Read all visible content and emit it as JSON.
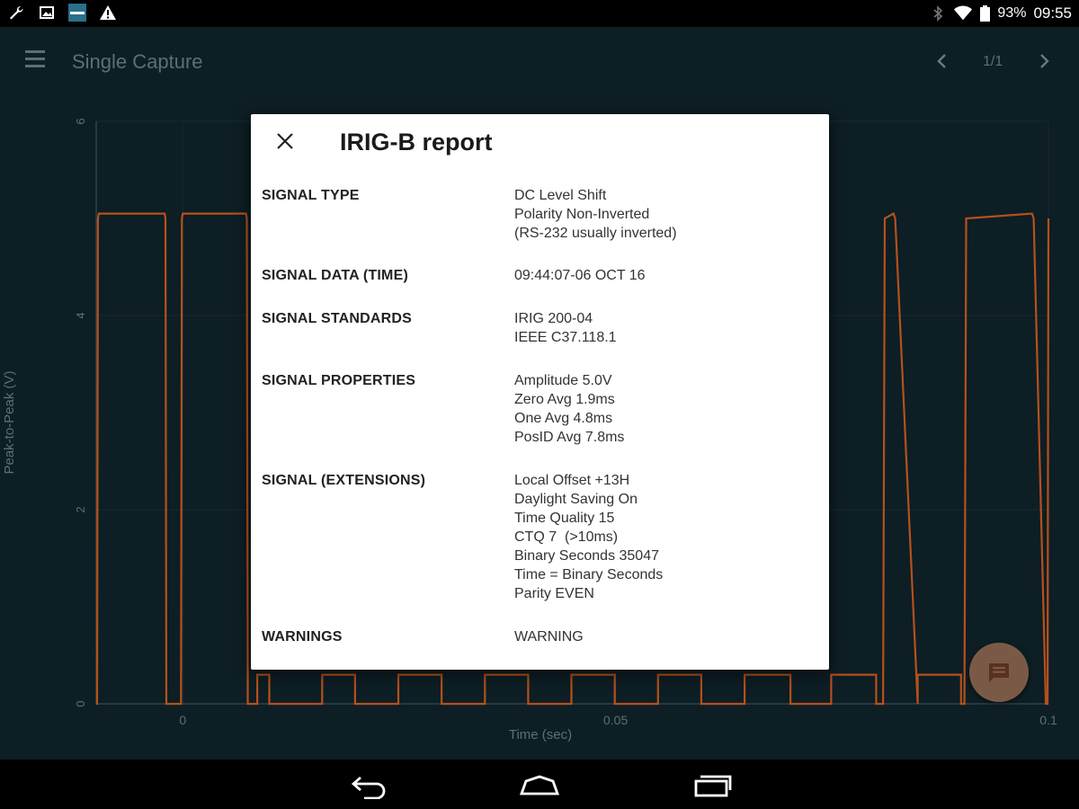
{
  "status_bar": {
    "battery": "93%",
    "time": "09:55",
    "left_icons": [
      "wrench-icon",
      "image-icon",
      "app-icon",
      "warning-icon"
    ],
    "right_icons": [
      "bluetooth-icon",
      "wifi-icon",
      "battery-icon"
    ]
  },
  "toolbar": {
    "title": "Single Capture",
    "page_indicator": "1/1"
  },
  "chart_data": {
    "type": "line",
    "xlabel": "Time (sec)",
    "ylabel": "Peak-to-Peak (V)",
    "x_ticks": [
      "0",
      "0.05",
      "0.1"
    ],
    "y_ticks": [
      "0",
      "2",
      "4",
      "6"
    ],
    "xlim": [
      -0.01,
      0.1
    ],
    "ylim": [
      0,
      6
    ],
    "line_color": "#b5501c",
    "series": [
      {
        "x": [
          -0.01,
          -0.0099,
          -0.0098,
          -0.0097,
          -0.0021,
          -0.002,
          -0.0019,
          -0.0002,
          -0.0001,
          0.0,
          0.0073,
          0.0074,
          0.0075,
          0.0075,
          0.0086,
          0.0086,
          0.01,
          0.01,
          0.0161,
          0.0161,
          0.0199,
          0.0199,
          0.0249,
          0.0249,
          0.0299,
          0.0299,
          0.0349,
          0.0349,
          0.0399,
          0.0399,
          0.0449,
          0.0449,
          0.0499,
          0.0499,
          0.0549,
          0.0549,
          0.0599,
          0.0599,
          0.0649,
          0.0649,
          0.0702,
          0.0702,
          0.0749,
          0.0749,
          0.0801,
          0.0801,
          0.0809,
          0.0811,
          0.0821,
          0.0823,
          0.0849,
          0.0849,
          0.0899,
          0.0899,
          0.0903,
          0.0905,
          0.0981,
          0.0983,
          0.0997,
          0.0999,
          0.1
        ],
        "y": [
          0,
          0,
          5.0,
          5.05,
          5.05,
          5.0,
          0,
          0,
          5.0,
          5.05,
          5.05,
          5.0,
          0.3,
          0,
          0,
          0.3,
          0.3,
          0,
          0,
          0.3,
          0.3,
          0,
          0,
          0.3,
          0.3,
          0,
          0,
          0.3,
          0.3,
          0,
          0,
          0.3,
          0.3,
          0,
          0,
          0.3,
          0.3,
          0,
          0,
          0.3,
          0.3,
          0,
          0,
          0.3,
          0.3,
          0,
          0,
          5.0,
          5.05,
          5.0,
          0,
          0.3,
          0.3,
          0,
          0,
          5.0,
          5.05,
          5.0,
          0,
          0,
          5.0
        ]
      }
    ]
  },
  "dialog": {
    "title": "IRIG-B report",
    "rows": [
      {
        "label": "SIGNAL TYPE",
        "values": [
          "DC Level Shift",
          "Polarity Non-Inverted",
          "(RS-232 usually inverted)"
        ]
      },
      {
        "label": "SIGNAL DATA (TIME)",
        "values": [
          "09:44:07-06 OCT 16"
        ]
      },
      {
        "label": "SIGNAL STANDARDS",
        "values": [
          "IRIG 200-04",
          "IEEE C37.118.1"
        ]
      },
      {
        "label": "SIGNAL PROPERTIES",
        "values": [
          "Amplitude 5.0V",
          "Zero Avg 1.9ms",
          "One Avg 4.8ms",
          "PosID Avg 7.8ms"
        ]
      },
      {
        "label": "SIGNAL (EXTENSIONS)",
        "values": [
          "Local Offset +13H",
          "Daylight Saving On",
          "Time Quality 15",
          "CTQ 7  (>10ms)",
          "Binary Seconds 35047",
          "Time = Binary Seconds",
          "Parity EVEN"
        ]
      },
      {
        "label": "WARNINGS",
        "values": [
          "WARNING"
        ]
      }
    ]
  },
  "fab": {
    "icon": "comment-icon"
  },
  "nav_bar": {
    "buttons": [
      "back-icon",
      "home-icon",
      "recents-icon"
    ]
  }
}
